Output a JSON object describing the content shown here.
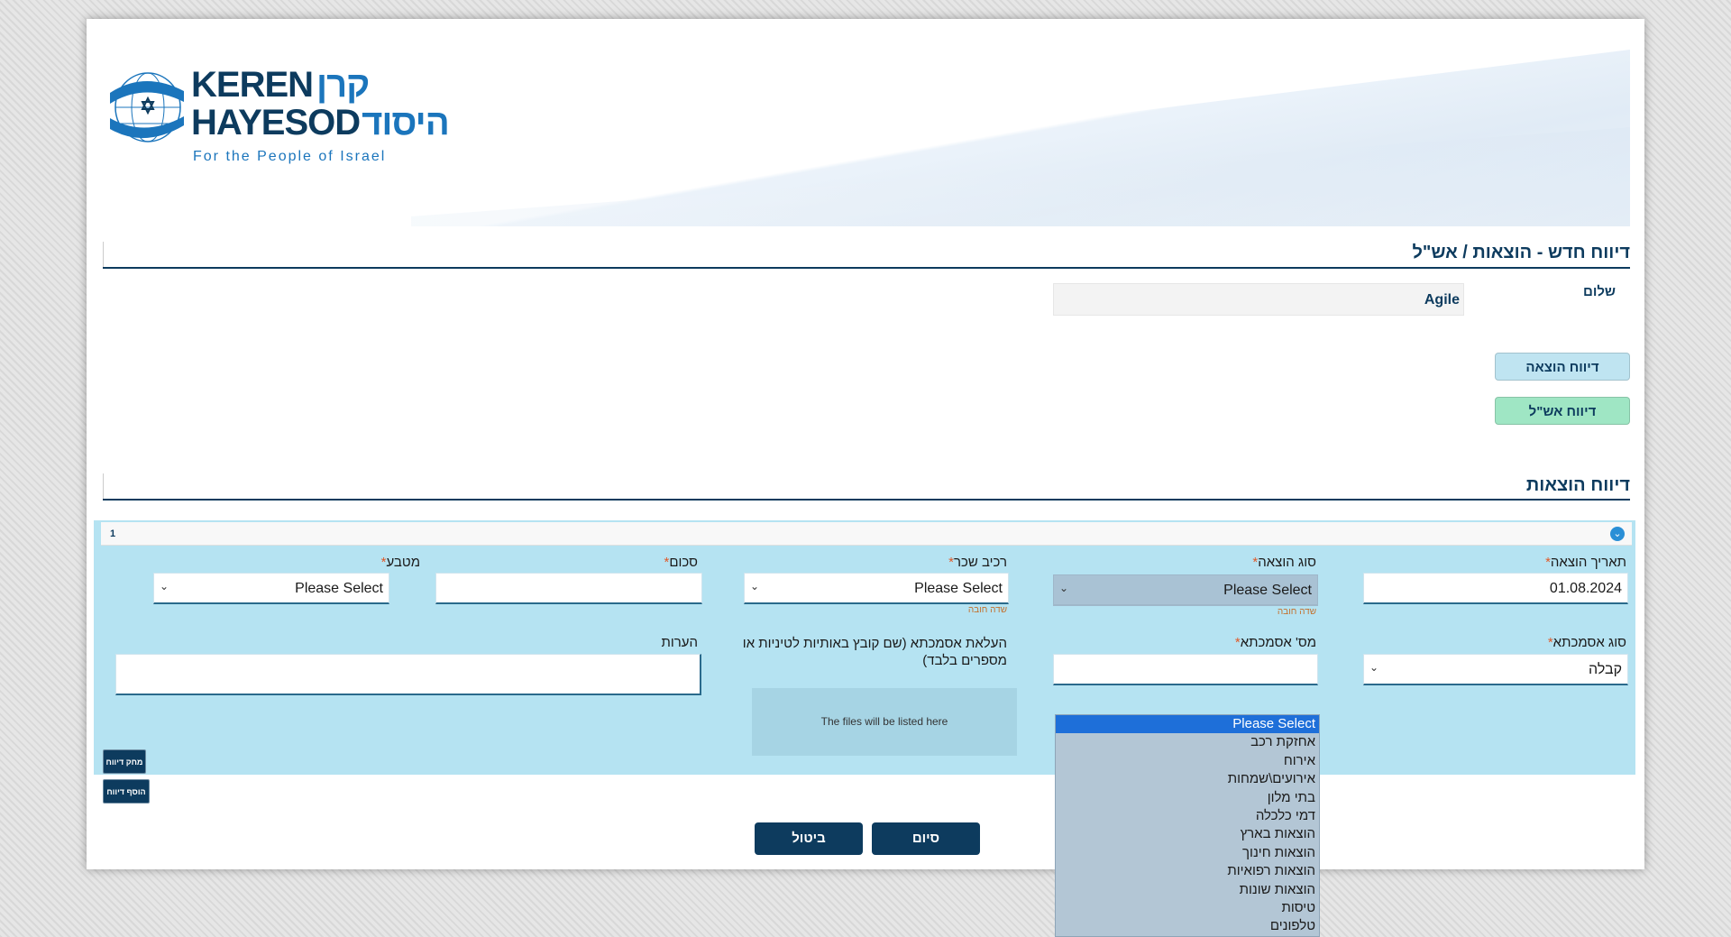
{
  "logo": {
    "line1_en": "KEREN",
    "line1_he": "קרן",
    "line2_en": "HAYESOD",
    "line2_he": "היסוד",
    "tagline": "For the People of Israel"
  },
  "page_title": "דיווח חדש - הוצאות / אש\"ל",
  "greeting": {
    "label": "שלום",
    "name": "Agile"
  },
  "report_buttons": {
    "expense": "דיווח הוצאה",
    "ashel": "דיווח אש\"ל"
  },
  "expenses_section_title": "דיווח הוצאות",
  "form": {
    "item_number": "1",
    "expense_date": {
      "label": "תאריך הוצאה",
      "value": "01.08.2024"
    },
    "expense_type": {
      "label": "סוג הוצאה",
      "value": "Please Select",
      "hint": "שדה חובה"
    },
    "rental_car": {
      "label": "רכיב שכר",
      "value": "Please Select",
      "hint": "שדה חובה"
    },
    "amount": {
      "label": "סכום",
      "value": ""
    },
    "currency": {
      "label": "מטבע",
      "value": "Please Select"
    },
    "reference_type": {
      "label": "סוג אסמכתא",
      "value": "קבלה"
    },
    "reference_number": {
      "label": "מס' אסמכתא",
      "value": ""
    },
    "upload": {
      "label": "העלאת אסמכתא (שם קובץ באותיות לטיניות או מספרים בלבד)",
      "placeholder": "The files will be listed here"
    },
    "notes": {
      "label": "הערות",
      "value": ""
    },
    "required_mark": "*"
  },
  "delete_report_label": "מחק דיווח",
  "add_report_label": "הוסף דיווח",
  "finish_label": "סיום",
  "cancel_label": "ביטול",
  "dropdown": {
    "options": [
      "Please Select",
      "אחזקת רכב",
      "אירוח",
      "אירועים\\שמחות",
      "בתי מלון",
      "דמי כלכלה",
      "הוצאות בארץ",
      "הוצאות חינוך",
      "הוצאות רפואיות",
      "הוצאות שונות",
      "טיסות",
      "טלפונים"
    ],
    "active_index": 0
  },
  "colors": {
    "brand_navy": "#0d3b5e",
    "panel_blue": "#b5e3f2",
    "pill_blue": "#bfe4f1",
    "pill_green": "#9fe6c4",
    "dropdown_highlight": "#1e6fd9"
  }
}
